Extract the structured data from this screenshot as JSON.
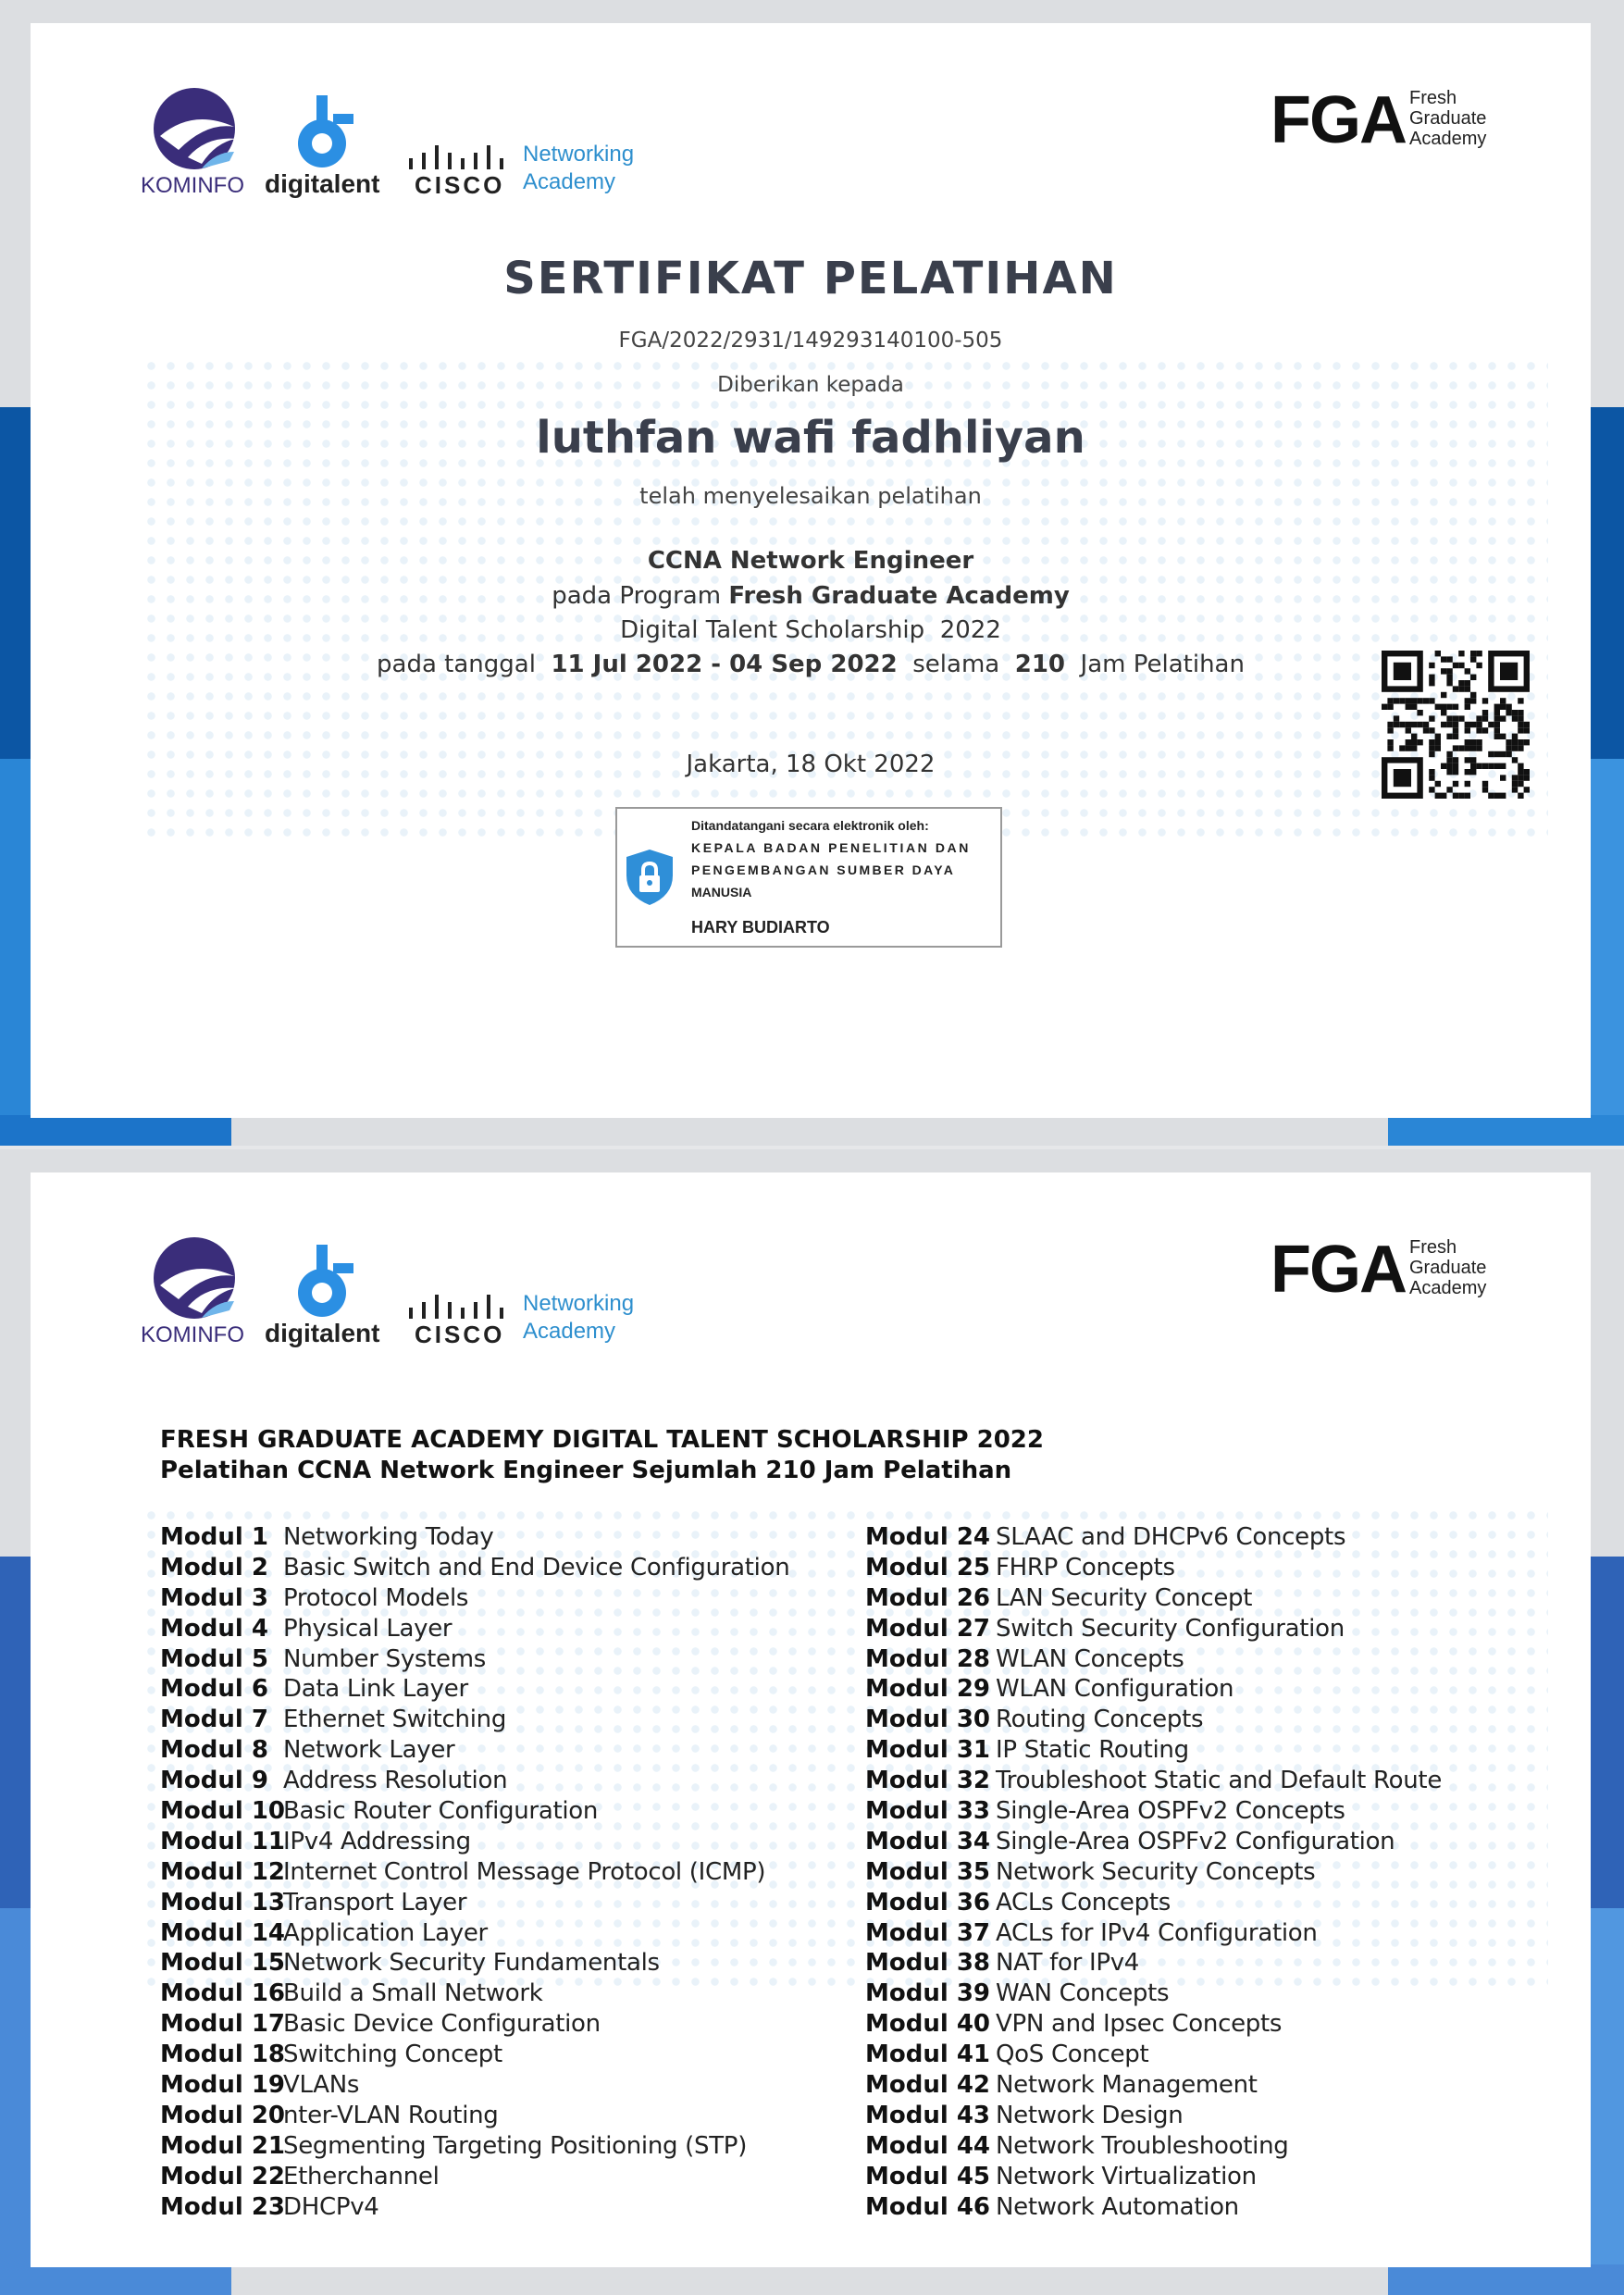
{
  "colors": {
    "band_light": "#4f9fe3",
    "band_mid": "#1f78cc",
    "band_dark": "#0c56a4",
    "kominfo_purple": "#3a2d7a",
    "digitalent_blue": "#2b8fe3",
    "cisco_blue": "#2e8fce",
    "text_dark": "#3a3f4c"
  },
  "logos": {
    "kominfo": "KOMINFO",
    "digitalent": "digitalent",
    "cisco": "CISCO",
    "networking": "Networking",
    "academy": "Academy",
    "fga": "FGA",
    "fga_line1": "Fresh",
    "fga_line2": "Graduate",
    "fga_line3": "Academy"
  },
  "certificate": {
    "title": "SERTIFIKAT PELATIHAN",
    "number": "FGA/2022/2931/149293140100-505",
    "given_to": "Diberikan kepada",
    "recipient": "luthfan wafi fadhliyan",
    "completed": "telah menyelesaikan pelatihan",
    "course": "CCNA Network Engineer",
    "program_prefix": "pada Program ",
    "program_name": "Fresh Graduate Academy",
    "scholarship": "Digital Talent Scholarship  2022",
    "date_prefix": "pada tanggal  ",
    "date_range": "11 Jul 2022 - 04 Sep 2022",
    "duration_prefix": "  selama  ",
    "hours": "210",
    "hours_suffix": "  Jam Pelatihan",
    "place_date": "Jakarta, 18 Okt 2022"
  },
  "signature": {
    "line1": "Ditandatangani secara elektronik oleh:",
    "line2": "KEPALA BADAN PENELITIAN DAN",
    "line3": "PENGEMBANGAN SUMBER DAYA",
    "line4": "MANUSIA",
    "signer": "HARY BUDIARTO"
  },
  "syllabus": {
    "heading1": "FRESH GRADUATE ACADEMY DIGITAL TALENT SCHOLARSHIP 2022",
    "heading2": "Pelatihan CCNA Network Engineer Sejumlah 210 Jam Pelatihan",
    "left": [
      {
        "key": "Modul 1",
        "name": "Networking Today"
      },
      {
        "key": "Modul 2",
        "name": "Basic Switch and End Device Configuration"
      },
      {
        "key": "Modul 3",
        "name": "Protocol Models"
      },
      {
        "key": "Modul 4",
        "name": "Physical Layer"
      },
      {
        "key": "Modul 5",
        "name": "Number Systems"
      },
      {
        "key": "Modul 6",
        "name": "Data Link Layer"
      },
      {
        "key": "Modul 7",
        "name": "Ethernet Switching"
      },
      {
        "key": "Modul 8",
        "name": "Network Layer"
      },
      {
        "key": "Modul 9",
        "name": "Address Resolution"
      },
      {
        "key": "Modul 10",
        "name": "Basic Router Configuration"
      },
      {
        "key": "Modul 11",
        "name": "IPv4 Addressing"
      },
      {
        "key": "Modul 12",
        "name": "Internet Control Message Protocol (ICMP)"
      },
      {
        "key": "Modul 13",
        "name": "Transport Layer"
      },
      {
        "key": "Modul 14",
        "name": "Application Layer"
      },
      {
        "key": "Modul 15",
        "name": "Network Security Fundamentals"
      },
      {
        "key": "Modul 16",
        "name": "Build a Small Network"
      },
      {
        "key": "Modul 17",
        "name": "Basic Device Configuration"
      },
      {
        "key": "Modul 18",
        "name": "Switching Concept"
      },
      {
        "key": "Modul 19",
        "name": "VLANs"
      },
      {
        "key": "Modul 20",
        "name": "nter-VLAN Routing"
      },
      {
        "key": "Modul 21",
        "name": "Segmenting Targeting Positioning (STP)"
      },
      {
        "key": "Modul 22",
        "name": "Etherchannel"
      },
      {
        "key": "Modul 23",
        "name": "DHCPv4"
      }
    ],
    "right": [
      {
        "key": "Modul 24",
        "name": "SLAAC and DHCPv6 Concepts"
      },
      {
        "key": "Modul 25",
        "name": "FHRP Concepts"
      },
      {
        "key": "Modul 26",
        "name": "LAN Security Concept"
      },
      {
        "key": "Modul 27",
        "name": "Switch Security Configuration"
      },
      {
        "key": "Modul 28",
        "name": "WLAN Concepts"
      },
      {
        "key": "Modul 29",
        "name": "WLAN Configuration"
      },
      {
        "key": "Modul 30",
        "name": "Routing Concepts"
      },
      {
        "key": "Modul 31",
        "name": "IP Static Routing"
      },
      {
        "key": "Modul 32",
        "name": "Troubleshoot Static and Default Route"
      },
      {
        "key": "Modul 33",
        "name": "Single-Area OSPFv2 Concepts"
      },
      {
        "key": "Modul 34",
        "name": "Single-Area OSPFv2 Configuration"
      },
      {
        "key": "Modul 35",
        "name": "Network Security Concepts"
      },
      {
        "key": "Modul 36",
        "name": "ACLs Concepts"
      },
      {
        "key": "Modul 37",
        "name": "ACLs for IPv4 Configuration"
      },
      {
        "key": "Modul 38",
        "name": "NAT for IPv4"
      },
      {
        "key": "Modul 39",
        "name": "WAN Concepts"
      },
      {
        "key": "Modul 40",
        "name": "VPN and Ipsec Concepts"
      },
      {
        "key": "Modul 41",
        "name": "QoS Concept"
      },
      {
        "key": "Modul 42",
        "name": "Network Management"
      },
      {
        "key": "Modul 43",
        "name": "Network Design"
      },
      {
        "key": "Modul 44",
        "name": "Network Troubleshooting"
      },
      {
        "key": "Modul 45",
        "name": "Network Virtualization"
      },
      {
        "key": "Modul 46",
        "name": "Network Automation"
      }
    ]
  },
  "icons": [
    "lock-shield-icon",
    "qr-code-icon",
    "kominfo-logo-icon",
    "digitalent-logo-icon",
    "cisco-logo-icon"
  ]
}
